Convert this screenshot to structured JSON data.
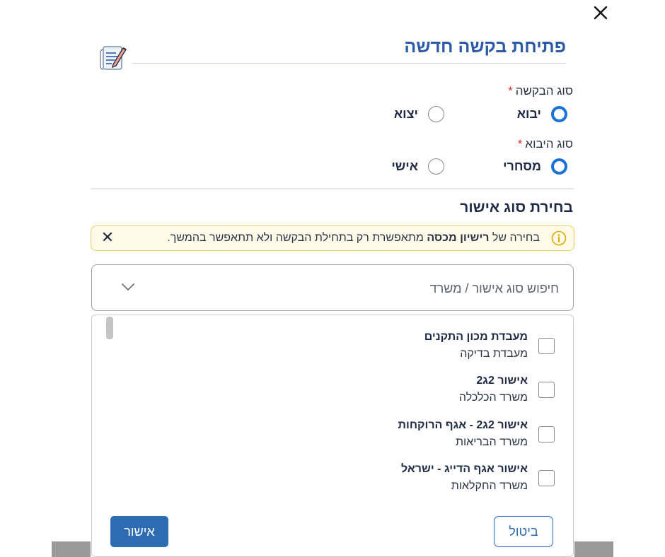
{
  "dialog": {
    "title": "פתיחת בקשה חדשה",
    "header_icon": "document-pen-icon",
    "close_icon": "close-icon"
  },
  "request_type": {
    "label": "סוג הבקשה",
    "required_mark": "*",
    "options": [
      {
        "label": "יבוא",
        "selected": true
      },
      {
        "label": "יצוא",
        "selected": false
      }
    ]
  },
  "import_type": {
    "label": "סוג היבוא",
    "required_mark": "*",
    "options": [
      {
        "label": "מסחרי",
        "selected": true
      },
      {
        "label": "אישי",
        "selected": false
      }
    ]
  },
  "approval_section": {
    "title": "בחירת סוג אישור",
    "notice": {
      "prefix": "בחירה של ",
      "bold": "רישיון מכסה",
      "suffix": " מתאפשרת רק בתחילת הבקשה ולא תתאפשר בהמשך.",
      "close_label": "✕",
      "info_icon": "info-icon"
    },
    "search": {
      "placeholder": "חיפוש סוג אישור / משרד",
      "value": ""
    },
    "items": [
      {
        "title": "מעבדת מכון התקנים",
        "subtitle": "מעבדת בדיקה",
        "checked": false
      },
      {
        "title": "אישור 2ג2",
        "subtitle": "משרד הכלכלה",
        "checked": false
      },
      {
        "title": "אישור 2ג2 - אגף הרוקחות",
        "subtitle": "משרד הבריאות",
        "checked": false
      },
      {
        "title": "אישור אגף הדייג - ישראל",
        "subtitle": "משרד החקלאות",
        "checked": false
      }
    ]
  },
  "footer": {
    "confirm_label": "אישור",
    "cancel_label": "ביטול"
  },
  "colors": {
    "accent": "#2e6db4",
    "title": "#2d5aa7",
    "radio_selected": "#1a72d6",
    "notice_border": "#f1cf5d",
    "notice_bg": "#fffbe8"
  }
}
